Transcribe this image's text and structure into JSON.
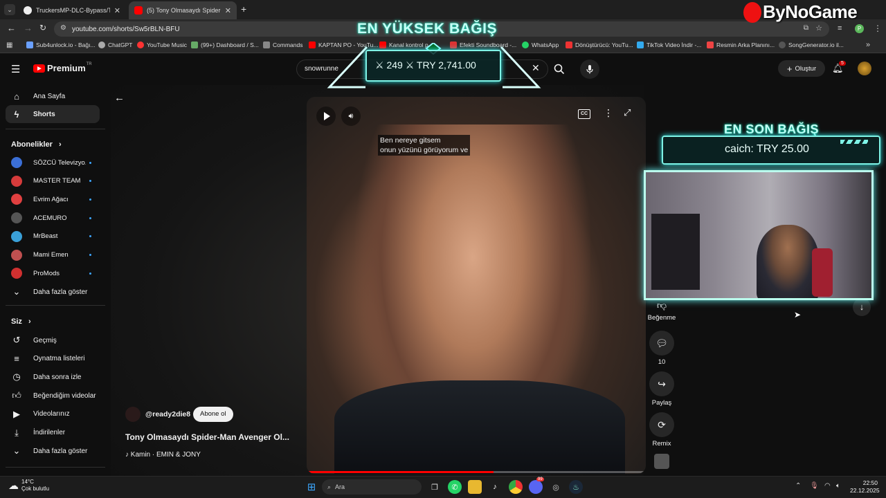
{
  "browser": {
    "tabs": [
      {
        "title": "TruckersMP-DLC-Bypass/Trucke",
        "close": "✕"
      },
      {
        "title": "(5) Tony Olmasaydı Spider-M",
        "close": "✕"
      }
    ],
    "new_tab": "+",
    "url": "youtube.com/shorts/Sw5rBLN-BFU",
    "bookmarks": [
      "Sub4unlock.io - Bağı...",
      "ChatGPT",
      "YouTube Music",
      "(99+) Dashboard / S...",
      "Commands",
      "KAPTAN PO - YouTu...",
      "Kanal kontrol p...",
      "Efekti Soundboard -...",
      "WhatsApp",
      "Dönüştürücü: YouTu...",
      "TikTok Video İndir -...",
      "Resmin Arka Planını...",
      "SongGenerator.io il..."
    ],
    "more_bookmarks": "»"
  },
  "youtube": {
    "logo_text": "Premium",
    "logo_sup": "TR",
    "search_value": "snowrunne",
    "create_label": "Oluştur",
    "notification_count": "5"
  },
  "sidebar": {
    "main": [
      {
        "label": "Ana Sayfa",
        "icon": "home-icon"
      },
      {
        "label": "Shorts",
        "icon": "shorts-icon"
      }
    ],
    "subscriptions_title": "Abonelikler",
    "subscriptions": [
      {
        "label": "SÖZCÜ Televizyo...",
        "color": "#3b6fd6"
      },
      {
        "label": "MASTER TEAM",
        "color": "#d63b3b"
      },
      {
        "label": "Evrim Ağacı",
        "color": "#e04040"
      },
      {
        "label": "ACEMURO",
        "color": "#555555"
      },
      {
        "label": "MrBeast",
        "color": "#3aa0d8"
      },
      {
        "label": "Mami Emen",
        "color": "#c05050"
      },
      {
        "label": "ProMods",
        "color": "#d03030"
      }
    ],
    "show_more_subs": "Daha fazla göster",
    "you_title": "Siz",
    "you_items": [
      {
        "label": "Geçmiş",
        "icon": "history-icon"
      },
      {
        "label": "Oynatma listeleri",
        "icon": "playlist-icon"
      },
      {
        "label": "Daha sonra izle",
        "icon": "clock-icon"
      },
      {
        "label": "Beğendiğim videolar",
        "icon": "thumbs-up-icon"
      },
      {
        "label": "Videolarınız",
        "icon": "video-icon"
      },
      {
        "label": "İndirilenler",
        "icon": "download-icon"
      },
      {
        "label": "Daha fazla göster",
        "icon": "chevron-down-icon"
      }
    ]
  },
  "short": {
    "caption_line1": "Ben nereye gitsem",
    "caption_line2": "onun yüzünü görüyorum ve",
    "channel": "@ready2die8",
    "subscribe_label": "Abone ol",
    "title": "Tony Olmasaydı Spider-Man Avenger Ol...",
    "music": "♪ Kamin · EMIN & JONY",
    "actions": {
      "dislike_label": "Beğenme",
      "comments_count": "10",
      "share_label": "Paylaş",
      "remix_label": "Remix"
    }
  },
  "overlay": {
    "brand": "ByNoGame",
    "top_title": "EN YÜKSEK BAĞIŞ",
    "top_value": "249 ⚔ TRY 2,741.00",
    "top_prefix": "⚔",
    "last_title": "EN SON BAĞIŞ",
    "last_value": "caich: TRY 25.00"
  },
  "taskbar": {
    "temperature": "14°C",
    "weather": "Çok bulutlu",
    "search_placeholder": "Ara",
    "time": "22:50",
    "date": "22.12.2025",
    "discord_badge": "99"
  }
}
